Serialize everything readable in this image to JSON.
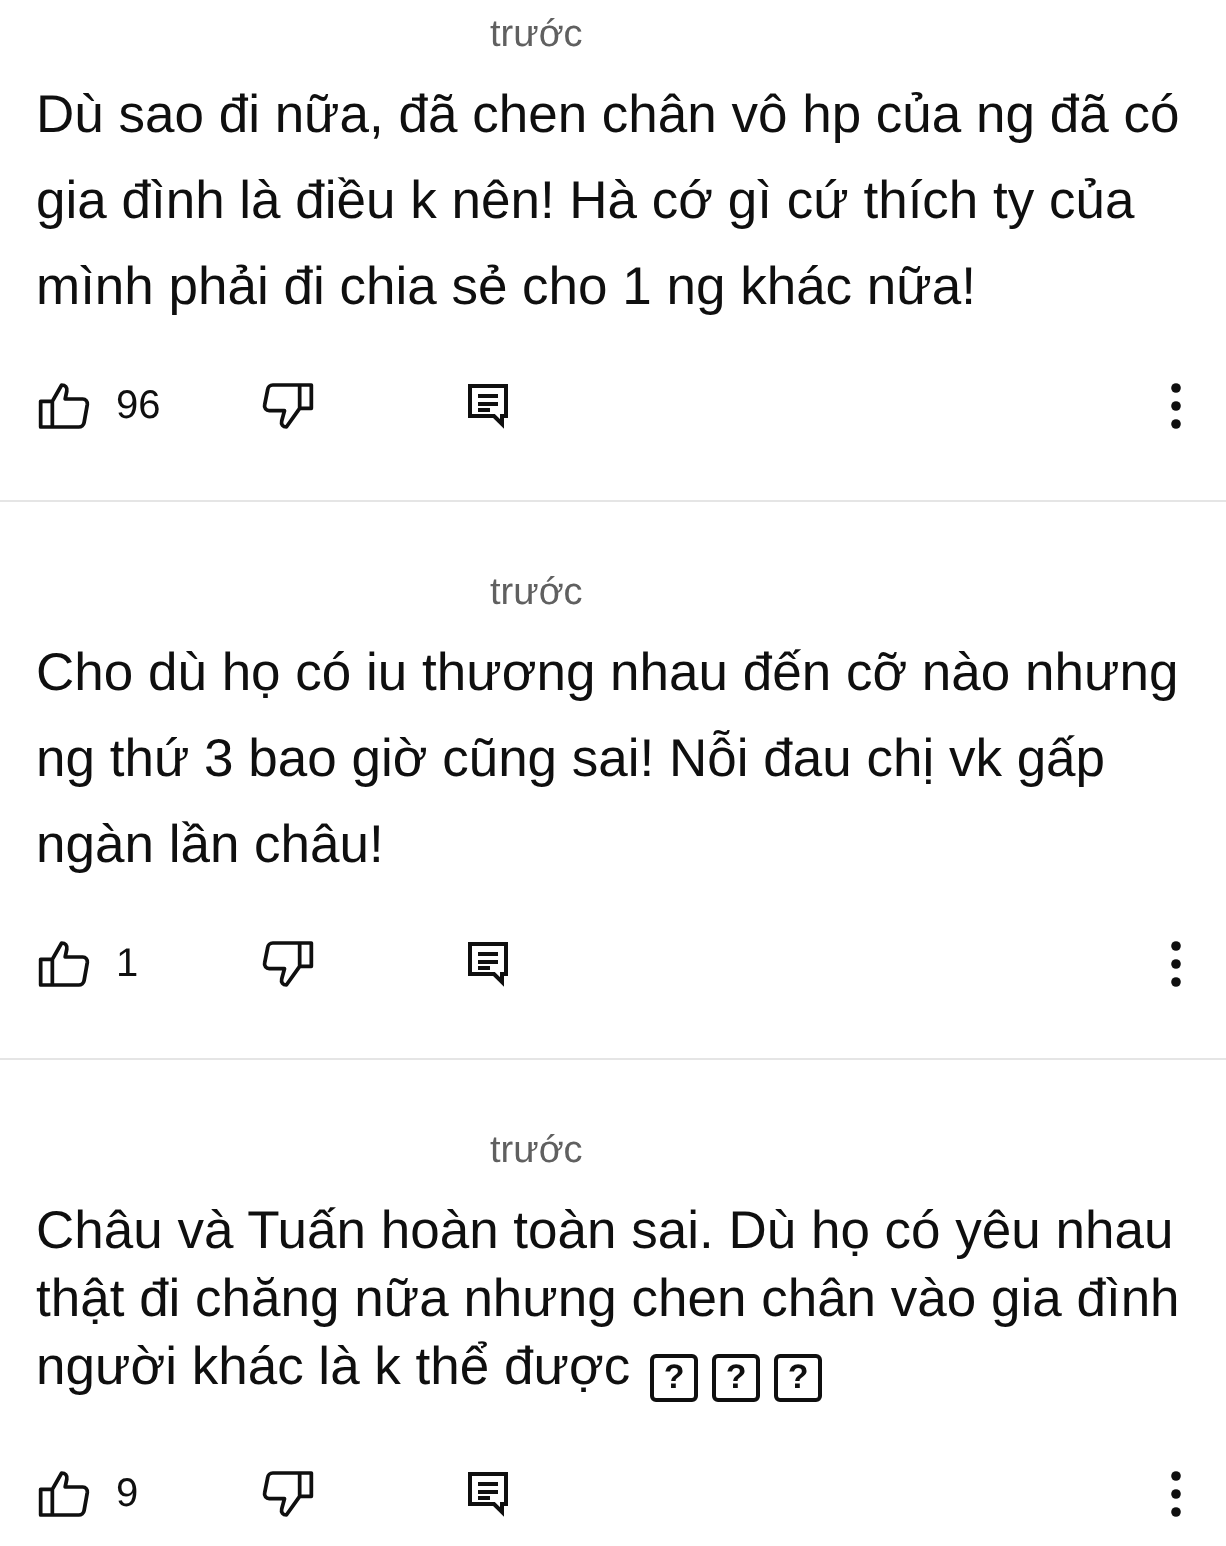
{
  "comments": [
    {
      "time": "trước",
      "text": "Dù sao đi nữa, đã chen chân vô hp của ng đã có gia đình là điều k nên! Hà cớ gì cứ thích ty của mình phải đi chia sẻ cho 1 ng khác nữa!",
      "likes": "96"
    },
    {
      "time": "trước",
      "text": "Cho dù họ có iu thương nhau đến cỡ nào nhưng ng thứ 3 bao giờ cũng sai! Nỗi đau chị vk gấp ngàn lần châu!",
      "likes": "1"
    },
    {
      "time": "trước",
      "text": "Châu và Tuấn hoàn toàn sai. Dù họ có yêu nhau thật đi chăng nữa nhưng chen chân vào gia đình người khác là k thể được",
      "missing_glyphs": [
        "?",
        "?",
        "?"
      ],
      "likes": "9"
    }
  ]
}
